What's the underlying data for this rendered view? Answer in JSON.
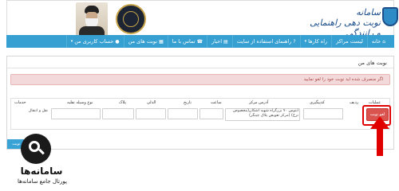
{
  "header": {
    "site_title_line1": "سامانه",
    "site_title_line2": "نوبت دهی راهنمایی و رانندگی"
  },
  "nav": {
    "items": [
      {
        "label": "خانه",
        "icon": "home-icon",
        "caret": false
      },
      {
        "label": "لیست مراکز",
        "icon": "",
        "caret": false
      },
      {
        "label": "راه کارها",
        "icon": "",
        "caret": true
      },
      {
        "label": "راهنمای استفاده از سایت",
        "icon": "question-icon",
        "caret": false
      },
      {
        "label": "اخبار",
        "icon": "news-icon",
        "caret": false
      },
      {
        "label": "تماس با ما",
        "icon": "phone-icon",
        "caret": false
      },
      {
        "label": "نوبت های من",
        "icon": "calendar-icon",
        "caret": false
      },
      {
        "label": "حساب کاربری من",
        "icon": "user-icon",
        "caret": true
      }
    ]
  },
  "panel": {
    "title": "نوبت های من",
    "alert": "اگر منصرف شده اید نوبت خود را لغو نمایید"
  },
  "table": {
    "headers": {
      "operations": "عملیات",
      "row": "ردیف",
      "tracking_code": "کدپیگیری",
      "center_address": "آدرس مرکز",
      "time": "ساعت",
      "date": "تاریخ",
      "day": "الدلی",
      "plate": "پلاک",
      "vehicle_type": "نوع وسیله نقلیه",
      "services": "خدمات"
    },
    "row": {
      "cancel_label": "لغو نوبت",
      "center_address": "ابتوس ۷۰ بزرگراه شهید اشکان(مخصوص ترخ) (مرکز تعویض پلاک چیتگر)",
      "services": "نقل و انتقال"
    }
  },
  "buttons": {
    "new_turn": "جدید نوبت"
  },
  "watermark": {
    "name": "سامانه‌ها",
    "subtitle": "پورتال جامع سامانه‌ها"
  },
  "colors": {
    "navbar": "#36a0d2",
    "alert_bg": "#f3d9d9",
    "cancel_button": "#d9534f",
    "highlight": "#e10000"
  }
}
